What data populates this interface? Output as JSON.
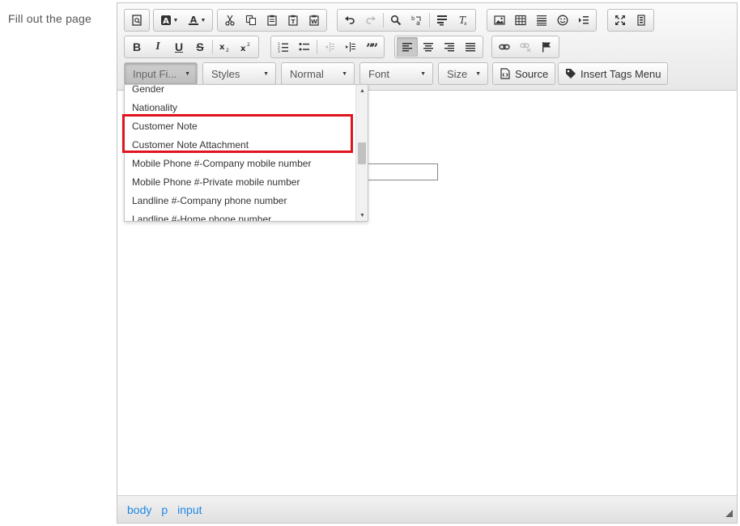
{
  "page": {
    "label": "Fill out the page"
  },
  "toolbar": {
    "style_combos": [
      {
        "label": "Input Fi...",
        "active": true
      },
      {
        "label": "Styles",
        "active": false
      },
      {
        "label": "Normal",
        "active": false
      },
      {
        "label": "Font",
        "active": false
      },
      {
        "label": "Size",
        "active": false
      }
    ],
    "source_label": "Source",
    "insert_tags_label": "Insert Tags Menu",
    "bold": "B",
    "italic": "I",
    "underline": "U",
    "strike": "S"
  },
  "dropdown": {
    "items": [
      "Gender",
      "Nationality",
      "Customer Note",
      "Customer Note Attachment",
      "Mobile Phone #-Company mobile number",
      "Mobile Phone #-Private mobile number",
      "Landline #-Company phone number",
      "Landline #-Home phone number"
    ],
    "highlighted": [
      "Customer Note",
      "Customer Note Attachment"
    ]
  },
  "statusbar": {
    "crumbs": [
      "body",
      "p",
      "input"
    ]
  },
  "colors": {
    "accent_link": "#1e88e5",
    "highlight_border": "#e0141e"
  }
}
